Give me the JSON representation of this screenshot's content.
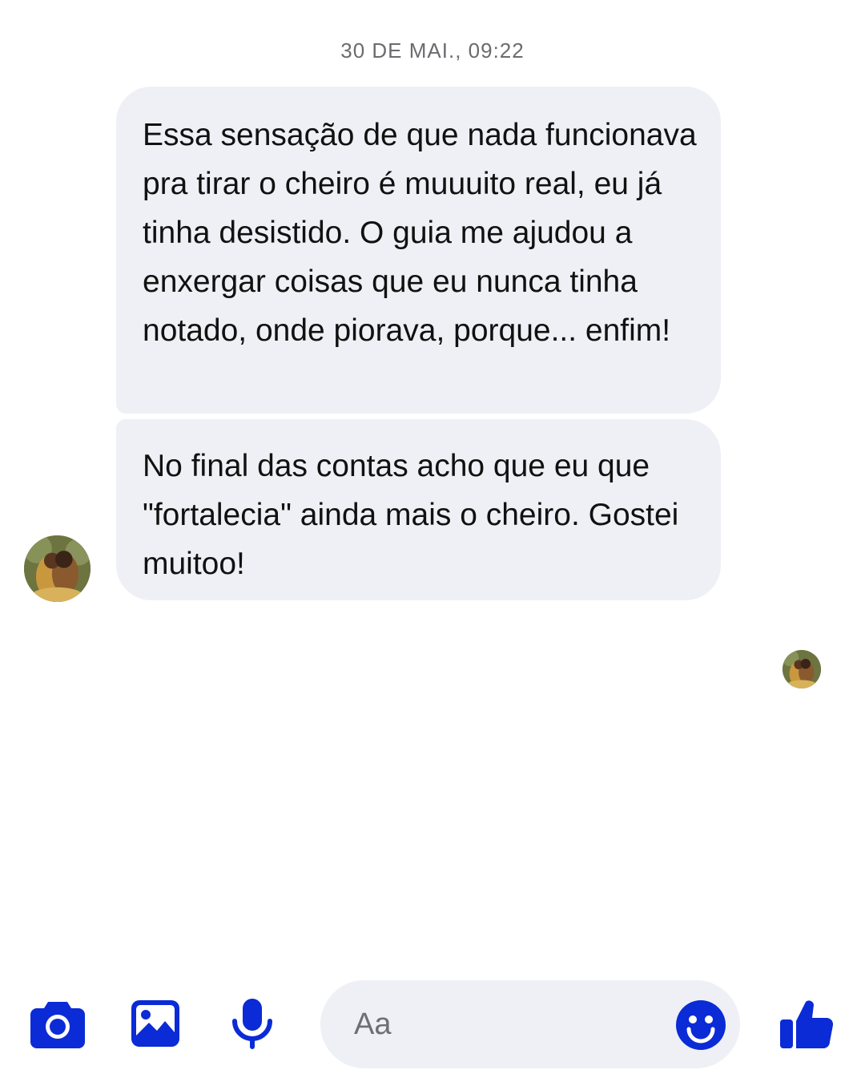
{
  "conversation": {
    "timestamp": "30 DE MAI., 09:22",
    "messages": [
      {
        "text": "Essa sensação de que nada funcionava pra tirar o cheiro é muuuito real, eu já tinha desistido. O guia me ajudou a enxergar coisas que eu nunca tinha notado, onde piorava, porque... enfim!"
      },
      {
        "text": "No final das contas acho que eu que \"fortalecia\" ainda mais o cheiro. Gostei muitoo!"
      }
    ]
  },
  "composer": {
    "placeholder": "Aa",
    "accent_color": "#0a2bd6",
    "icons": [
      "camera-icon",
      "image-icon",
      "microphone-icon",
      "emoji-icon",
      "thumbs-up-icon"
    ]
  }
}
